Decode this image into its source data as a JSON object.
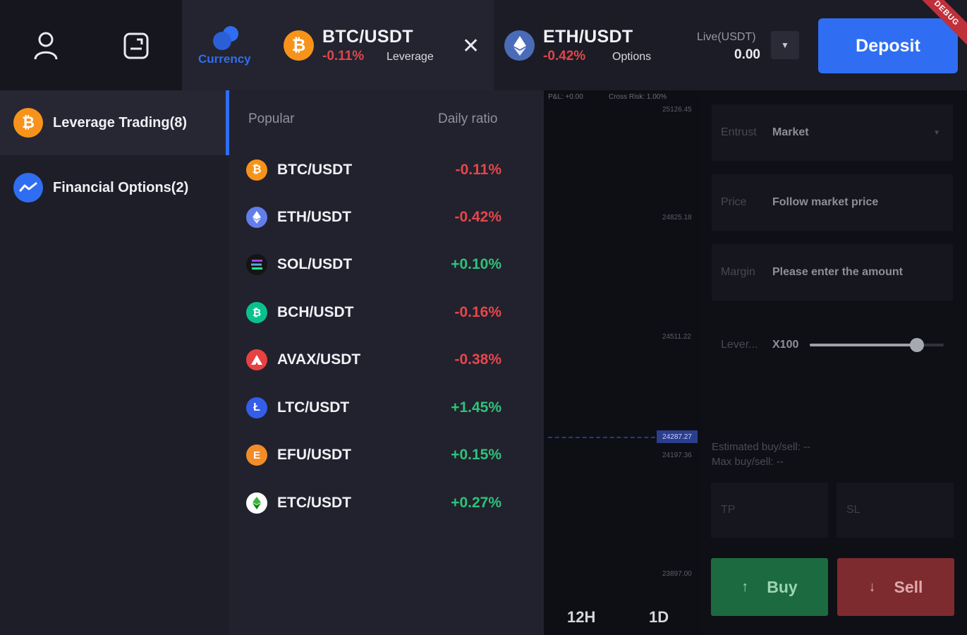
{
  "top": {
    "currency_label": "Currency",
    "tabs": [
      {
        "pair": "BTC/USDT",
        "change": "-0.11%",
        "type": "Leverage"
      },
      {
        "pair": "ETH/USDT",
        "change": "-0.42%",
        "type": "Options"
      }
    ],
    "close_symbol": "✕",
    "live_label": "Live(USDT)",
    "live_value": "0.00",
    "deposit_label": "Deposit",
    "debug_label": "DEBUG"
  },
  "sidebar": {
    "items": [
      {
        "label": "Leverage Trading(8)",
        "icon": "bitcoin-icon",
        "active": true
      },
      {
        "label": "Financial Options(2)",
        "icon": "trend-icon",
        "active": false
      }
    ]
  },
  "market_list": {
    "header_left": "Popular",
    "header_right": "Daily ratio",
    "rows": [
      {
        "pair": "BTC/USDT",
        "ratio": "-0.11%",
        "icon": "btc-coin-icon",
        "color": "#f7931a"
      },
      {
        "pair": "ETH/USDT",
        "ratio": "-0.42%",
        "icon": "eth-coin-icon",
        "color": "#627eea"
      },
      {
        "pair": "SOL/USDT",
        "ratio": "+0.10%",
        "icon": "sol-coin-icon",
        "color": "#1a1a1a"
      },
      {
        "pair": "BCH/USDT",
        "ratio": "-0.16%",
        "icon": "bch-coin-icon",
        "color": "#0ac18e"
      },
      {
        "pair": "AVAX/USDT",
        "ratio": "-0.38%",
        "icon": "avax-coin-icon",
        "color": "#e84142"
      },
      {
        "pair": "LTC/USDT",
        "ratio": "+1.45%",
        "icon": "ltc-coin-icon",
        "color": "#345de9"
      },
      {
        "pair": "EFU/USDT",
        "ratio": "+0.15%",
        "icon": "efu-coin-icon",
        "color": "#f7931a"
      },
      {
        "pair": "ETC/USDT",
        "ratio": "+0.27%",
        "icon": "etc-coin-icon",
        "color": "#ffffff"
      }
    ]
  },
  "chart": {
    "pnl": "P&L: +0.00",
    "cross_risk": "Cross Risk: 1.00%",
    "ticks": [
      "25126.45",
      "24825.18",
      "24511.22",
      "24197.36",
      "23897.00"
    ],
    "price_tag": "24287.27",
    "periods": [
      "12H",
      "1D"
    ]
  },
  "order_form": {
    "entrust_label": "Entrust",
    "entrust_value": "Market",
    "price_label": "Price",
    "price_value": "Follow market price",
    "margin_label": "Margin",
    "margin_placeholder": "Please enter the amount",
    "lever_label": "Lever...",
    "lever_value": "X100",
    "lever_level": 0.8,
    "estimated": "Estimated buy/sell: --",
    "max": "Max buy/sell: --",
    "tp_label": "TP",
    "sl_label": "SL",
    "buy_label": "Buy",
    "sell_label": "Sell"
  }
}
